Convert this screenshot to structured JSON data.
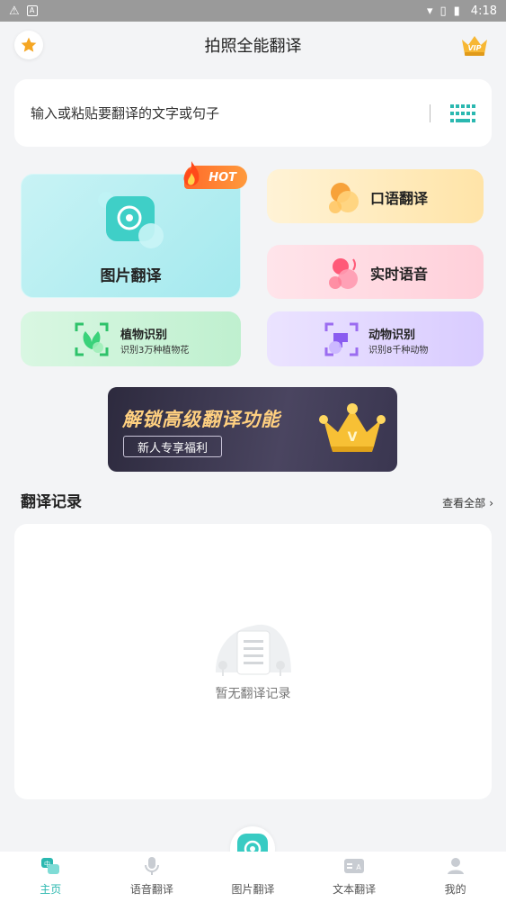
{
  "status_bar": {
    "time": "4:18"
  },
  "header": {
    "title": "拍照全能翻译"
  },
  "input": {
    "placeholder": "输入或粘贴要翻译的文字或句子"
  },
  "features": {
    "photo": {
      "label": "图片翻译",
      "badge": "HOT"
    },
    "oral": {
      "label": "口语翻译"
    },
    "realtime": {
      "label": "实时语音"
    },
    "plant": {
      "label": "植物识别",
      "desc": "识别3万种植物花"
    },
    "animal": {
      "label": "动物识别",
      "desc": "识别8千种动物"
    }
  },
  "banner": {
    "title": "解锁高级翻译功能",
    "button": "新人专享福利"
  },
  "history": {
    "title": "翻译记录",
    "view_all": "查看全部",
    "empty_text": "暂无翻译记录"
  },
  "nav": {
    "home": "主页",
    "voice": "语音翻译",
    "photo": "图片翻译",
    "text": "文本翻译",
    "mine": "我的"
  },
  "colors": {
    "accent": "#2bb8b0",
    "hot": "#ff6a2a",
    "banner_gold": "#ffd080"
  }
}
